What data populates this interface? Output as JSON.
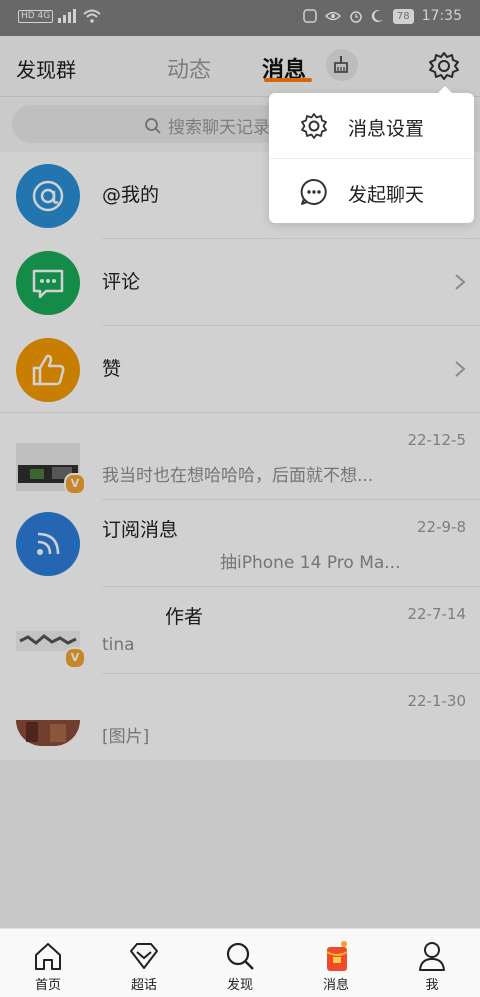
{
  "status_bar": {
    "left_indicators": "HD 4G",
    "battery": "78",
    "time": "17:35"
  },
  "header": {
    "left_title": "发现群",
    "tabs": [
      {
        "label": "动态",
        "active": false
      },
      {
        "label": "消息",
        "active": true
      }
    ],
    "sweep_icon": "broom-icon",
    "settings_icon": "gear-icon"
  },
  "search": {
    "placeholder": "搜索聊天记录"
  },
  "list": [
    {
      "title": "@我的",
      "avatar_color": "#2b8fd6",
      "icon": "at-icon"
    },
    {
      "title": "评论",
      "avatar_color": "#1aaa5a",
      "icon": "chat-bubble-icon"
    },
    {
      "title": "赞",
      "avatar_color": "#f59a00",
      "icon": "thumbs-up-icon"
    },
    {
      "title": "",
      "date": "22-12-5",
      "sub": "我当时也在想哈哈哈，后面就不想..."
    },
    {
      "title": "订阅消息",
      "date": "22-9-8",
      "sub": "抽iPhone 14 Pro Ma...",
      "avatar_color": "#2e7ddb",
      "icon": "rss-icon"
    },
    {
      "title": "作者",
      "date": "22-7-14",
      "sub": "tina"
    },
    {
      "title": "",
      "date": "22-1-30",
      "sub": "[图片]"
    }
  ],
  "popup_menu": [
    {
      "label": "消息设置",
      "icon": "gear-icon"
    },
    {
      "label": "发起聊天",
      "icon": "chat-dots-icon"
    }
  ],
  "bottom_nav": [
    {
      "label": "首页",
      "icon": "home-icon"
    },
    {
      "label": "超话",
      "icon": "diamond-icon"
    },
    {
      "label": "发现",
      "icon": "search-icon"
    },
    {
      "label": "消息",
      "icon": "red-packet-icon"
    },
    {
      "label": "我",
      "icon": "person-icon"
    }
  ],
  "colors": {
    "accent": "#ff8200",
    "verified_badge": "#f3a531"
  }
}
